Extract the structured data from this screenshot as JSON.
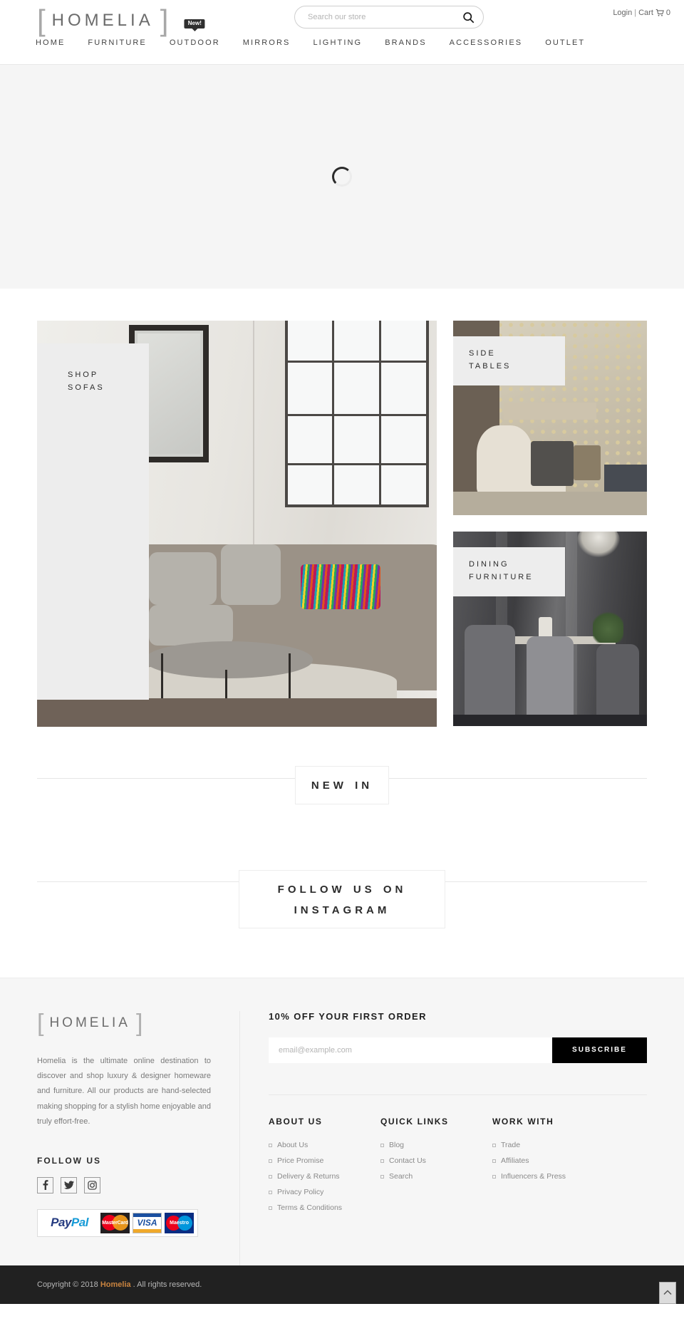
{
  "header": {
    "logo": {
      "open_bracket": "[",
      "text": "HOMELIA",
      "close_bracket": "]"
    },
    "search": {
      "placeholder": "Search our store",
      "value": "",
      "icon": "search-icon"
    },
    "account": {
      "login": "Login",
      "separator": "|",
      "cart": "Cart",
      "cart_icon": "cart-icon",
      "cart_count": "0"
    },
    "nav": [
      {
        "label": "HOME",
        "badge": null
      },
      {
        "label": "FURNITURE",
        "badge": null
      },
      {
        "label": "OUTDOOR",
        "badge": "New!"
      },
      {
        "label": "MIRRORS",
        "badge": null
      },
      {
        "label": "LIGHTING",
        "badge": null
      },
      {
        "label": "BRANDS",
        "badge": null
      },
      {
        "label": "ACCESSORIES",
        "badge": null
      },
      {
        "label": "OUTLET",
        "badge": null
      }
    ]
  },
  "hero": {
    "state": "loading",
    "spinner_icon": "loading-spinner-icon",
    "background_color": "#f5f5f5"
  },
  "tiles": [
    {
      "label_line1": "SHOP",
      "label_line2": "SOFAS",
      "name": "tile-shop-sofas"
    },
    {
      "label_line1": "SIDE",
      "label_line2": "TABLES",
      "name": "tile-side-tables"
    },
    {
      "label_line1": "DINING",
      "label_line2": "FURNITURE",
      "name": "tile-dining-furniture"
    }
  ],
  "sections": [
    {
      "title_boxed": "NEW",
      "title_rest": "IN",
      "name": "new-in"
    },
    {
      "title_boxed": "FOLLOW US ON",
      "title_rest": "INSTAGRAM",
      "name": "follow-us-on-instagram"
    }
  ],
  "footer": {
    "logo": {
      "open_bracket": "[",
      "text": "HOMELIA",
      "close_bracket": "]"
    },
    "description": "Homelia is the ultimate online destination to discover and shop luxury & designer homeware and furniture. All our products are hand-selected making shopping for a stylish home enjoyable and truly effort-free.",
    "follow_title": "FOLLOW US",
    "social": [
      {
        "name": "facebook-icon",
        "glyph": "f"
      },
      {
        "name": "twitter-icon",
        "glyph": "t"
      },
      {
        "name": "instagram-icon",
        "glyph": "i"
      }
    ],
    "payments": [
      {
        "name": "paypal-badge",
        "label": "PayPal",
        "part1": "Pay",
        "part2": "Pal"
      },
      {
        "name": "mastercard-badge",
        "label": "MasterCard"
      },
      {
        "name": "visa-badge",
        "label": "VISA"
      },
      {
        "name": "maestro-badge",
        "label": "Maestro"
      }
    ],
    "newsletter": {
      "title": "10% OFF YOUR FIRST ORDER",
      "placeholder": "email@example.com",
      "value": "",
      "button": "SUBSCRIBE"
    },
    "link_columns": [
      {
        "heading": "ABOUT US",
        "links": [
          "About Us",
          "Price Promise",
          "Delivery & Returns",
          "Privacy Policy",
          "Terms & Conditions"
        ]
      },
      {
        "heading": "QUICK LINKS",
        "links": [
          "Blog",
          "Contact Us",
          "Search"
        ]
      },
      {
        "heading": "WORK WITH",
        "links": [
          "Trade",
          "Affiliates",
          "Influencers & Press"
        ]
      }
    ]
  },
  "copyright": {
    "prefix": "Copyright © 2018 ",
    "brand": "Homelia",
    "suffix": " . All rights reserved.",
    "brand_color": "#c8833f",
    "to_top_icon": "chevron-up-icon"
  }
}
